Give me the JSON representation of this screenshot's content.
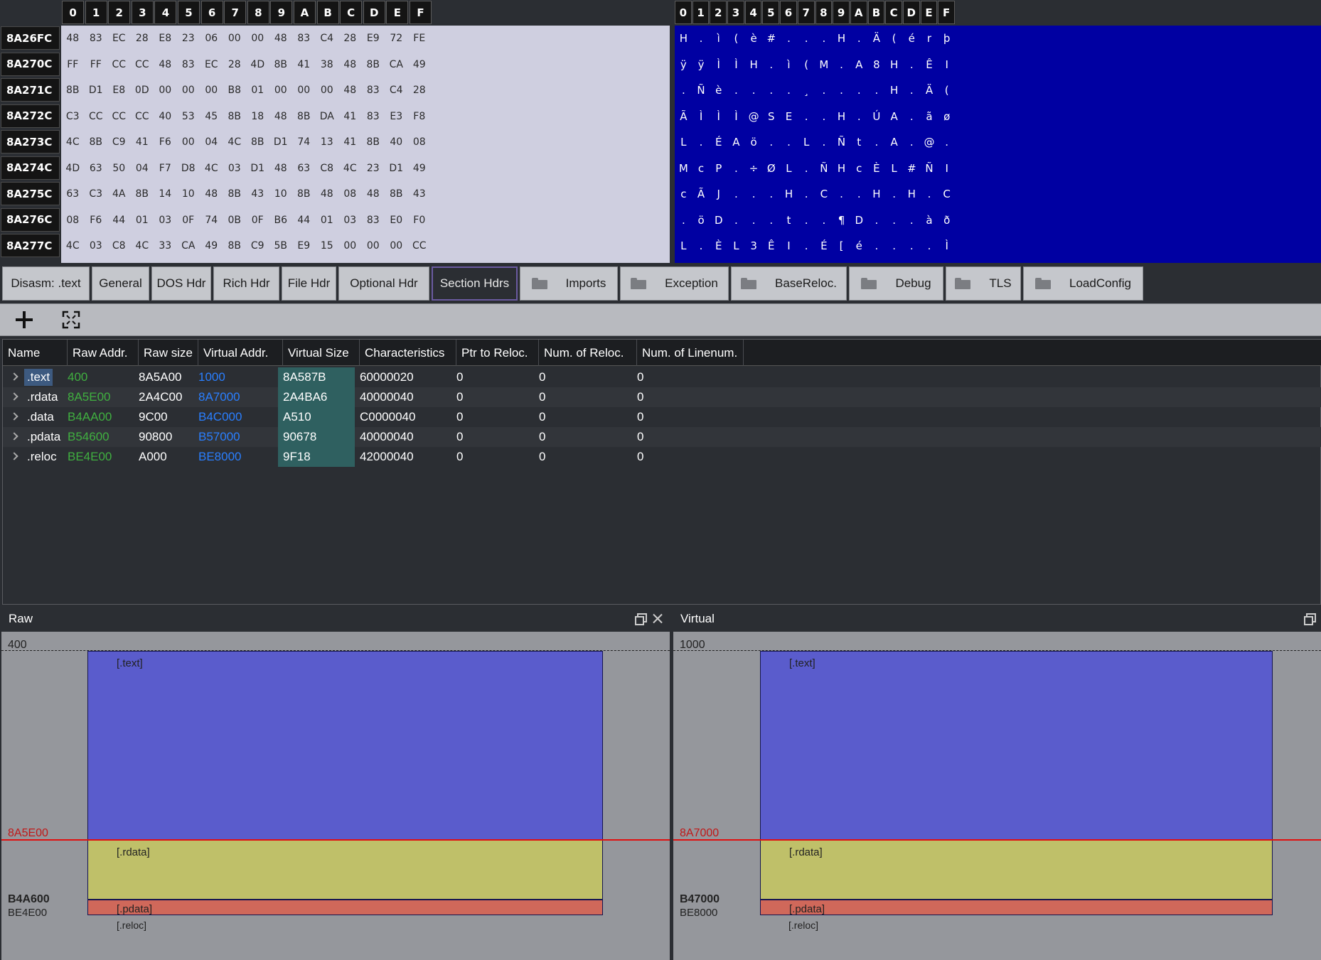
{
  "hex": {
    "columns": [
      "0",
      "1",
      "2",
      "3",
      "4",
      "5",
      "6",
      "7",
      "8",
      "9",
      "A",
      "B",
      "C",
      "D",
      "E",
      "F"
    ],
    "rows": [
      {
        "addr": "8A26FC",
        "bytes": [
          "48",
          "83",
          "EC",
          "28",
          "E8",
          "23",
          "06",
          "00",
          "00",
          "48",
          "83",
          "C4",
          "28",
          "E9",
          "72",
          "FE"
        ],
        "ascii": [
          "H",
          ".",
          "ì",
          "(",
          "è",
          "#",
          ".",
          ".",
          ".",
          "H",
          ".",
          "Ä",
          "(",
          "é",
          "r",
          "þ"
        ]
      },
      {
        "addr": "8A270C",
        "bytes": [
          "FF",
          "FF",
          "CC",
          "CC",
          "48",
          "83",
          "EC",
          "28",
          "4D",
          "8B",
          "41",
          "38",
          "48",
          "8B",
          "CA",
          "49"
        ],
        "ascii": [
          "ÿ",
          "ÿ",
          "Ì",
          "Ì",
          "H",
          ".",
          "ì",
          "(",
          "M",
          ".",
          "A",
          "8",
          "H",
          ".",
          "Ê",
          "I"
        ]
      },
      {
        "addr": "8A271C",
        "bytes": [
          "8B",
          "D1",
          "E8",
          "0D",
          "00",
          "00",
          "00",
          "B8",
          "01",
          "00",
          "00",
          "00",
          "48",
          "83",
          "C4",
          "28"
        ],
        "ascii": [
          ".",
          "Ñ",
          "è",
          ".",
          ".",
          ".",
          ".",
          "¸",
          ".",
          ".",
          ".",
          ".",
          "H",
          ".",
          "Ä",
          "("
        ]
      },
      {
        "addr": "8A272C",
        "bytes": [
          "C3",
          "CC",
          "CC",
          "CC",
          "40",
          "53",
          "45",
          "8B",
          "18",
          "48",
          "8B",
          "DA",
          "41",
          "83",
          "E3",
          "F8"
        ],
        "ascii": [
          "Ã",
          "Ì",
          "Ì",
          "Ì",
          "@",
          "S",
          "E",
          ".",
          ".",
          "H",
          ".",
          "Ú",
          "A",
          ".",
          "ã",
          "ø"
        ]
      },
      {
        "addr": "8A273C",
        "bytes": [
          "4C",
          "8B",
          "C9",
          "41",
          "F6",
          "00",
          "04",
          "4C",
          "8B",
          "D1",
          "74",
          "13",
          "41",
          "8B",
          "40",
          "08"
        ],
        "ascii": [
          "L",
          ".",
          "É",
          "A",
          "ö",
          ".",
          ".",
          "L",
          ".",
          "Ñ",
          "t",
          ".",
          "A",
          ".",
          "@",
          "."
        ]
      },
      {
        "addr": "8A274C",
        "bytes": [
          "4D",
          "63",
          "50",
          "04",
          "F7",
          "D8",
          "4C",
          "03",
          "D1",
          "48",
          "63",
          "C8",
          "4C",
          "23",
          "D1",
          "49"
        ],
        "ascii": [
          "M",
          "c",
          "P",
          ".",
          "÷",
          "Ø",
          "L",
          ".",
          "Ñ",
          "H",
          "c",
          "È",
          "L",
          "#",
          "Ñ",
          "I"
        ]
      },
      {
        "addr": "8A275C",
        "bytes": [
          "63",
          "C3",
          "4A",
          "8B",
          "14",
          "10",
          "48",
          "8B",
          "43",
          "10",
          "8B",
          "48",
          "08",
          "48",
          "8B",
          "43"
        ],
        "ascii": [
          "c",
          "Ã",
          "J",
          ".",
          ".",
          ".",
          "H",
          ".",
          "C",
          ".",
          ".",
          "H",
          ".",
          "H",
          ".",
          "C"
        ]
      },
      {
        "addr": "8A276C",
        "bytes": [
          "08",
          "F6",
          "44",
          "01",
          "03",
          "0F",
          "74",
          "0B",
          "0F",
          "B6",
          "44",
          "01",
          "03",
          "83",
          "E0",
          "F0"
        ],
        "ascii": [
          ".",
          "ö",
          "D",
          ".",
          ".",
          ".",
          "t",
          ".",
          ".",
          "¶",
          "D",
          ".",
          ".",
          ".",
          "à",
          "ð"
        ]
      },
      {
        "addr": "8A277C",
        "bytes": [
          "4C",
          "03",
          "C8",
          "4C",
          "33",
          "CA",
          "49",
          "8B",
          "C9",
          "5B",
          "E9",
          "15",
          "00",
          "00",
          "00",
          "CC"
        ],
        "ascii": [
          "L",
          ".",
          "È",
          "L",
          "3",
          "Ê",
          "I",
          ".",
          "É",
          "[",
          "é",
          ".",
          ".",
          ".",
          ".",
          "Ì"
        ]
      }
    ]
  },
  "tabs": [
    {
      "label": "Disasm: .text",
      "folder": false,
      "active": false
    },
    {
      "label": "General",
      "folder": false,
      "active": false
    },
    {
      "label": "DOS Hdr",
      "folder": false,
      "active": false
    },
    {
      "label": "Rich Hdr",
      "folder": false,
      "active": false
    },
    {
      "label": "File Hdr",
      "folder": false,
      "active": false
    },
    {
      "label": "Optional Hdr",
      "folder": false,
      "active": false
    },
    {
      "label": "Section Hdrs",
      "folder": false,
      "active": true
    },
    {
      "label": "Imports",
      "folder": true,
      "active": false
    },
    {
      "label": "Exception",
      "folder": true,
      "active": false
    },
    {
      "label": "BaseReloc.",
      "folder": true,
      "active": false
    },
    {
      "label": "Debug",
      "folder": true,
      "active": false
    },
    {
      "label": "TLS",
      "folder": true,
      "active": false
    },
    {
      "label": "LoadConfig",
      "folder": true,
      "active": false
    }
  ],
  "toolbar": {
    "add_icon": "plus-icon",
    "fit_icon": "fit-to-view-icon"
  },
  "table": {
    "headers": [
      "Name",
      "Raw Addr.",
      "Raw size",
      "Virtual Addr.",
      "Virtual Size",
      "Characteristics",
      "Ptr to Reloc.",
      "Num. of Reloc.",
      "Num. of Linenum."
    ],
    "rows": [
      {
        "name": ".text",
        "raw_addr": "400",
        "raw_size": "8A5A00",
        "virt_addr": "1000",
        "virt_size": "8A587B",
        "characteristics": "60000020",
        "ptr_reloc": "0",
        "num_reloc": "0",
        "num_linenum": "0"
      },
      {
        "name": ".rdata",
        "raw_addr": "8A5E00",
        "raw_size": "2A4C00",
        "virt_addr": "8A7000",
        "virt_size": "2A4BA6",
        "characteristics": "40000040",
        "ptr_reloc": "0",
        "num_reloc": "0",
        "num_linenum": "0"
      },
      {
        "name": ".data",
        "raw_addr": "B4AA00",
        "raw_size": "9C00",
        "virt_addr": "B4C000",
        "virt_size": "A510",
        "characteristics": "C0000040",
        "ptr_reloc": "0",
        "num_reloc": "0",
        "num_linenum": "0"
      },
      {
        "name": ".pdata",
        "raw_addr": "B54600",
        "raw_size": "90800",
        "virt_addr": "B57000",
        "virt_size": "90678",
        "characteristics": "40000040",
        "ptr_reloc": "0",
        "num_reloc": "0",
        "num_linenum": "0"
      },
      {
        "name": ".reloc",
        "raw_addr": "BE4E00",
        "raw_size": "A000",
        "virt_addr": "BE8000",
        "virt_size": "9F18",
        "characteristics": "42000040",
        "ptr_reloc": "0",
        "num_reloc": "0",
        "num_linenum": "0"
      }
    ]
  },
  "raw_pane": {
    "title": "Raw",
    "top_offset": "400",
    "rdata_offset": "8A5E00",
    "data_offset": "B4A600",
    "end_offset": "BE4E00",
    "labels": {
      "text": "[.text]",
      "rdata": "[.rdata]",
      "data": "[.pdata]",
      "reloc": "[.reloc]"
    }
  },
  "virtual_pane": {
    "title": "Virtual",
    "top_offset": "1000",
    "rdata_offset": "8A7000",
    "data_offset": "B47000",
    "end_offset": "BE8000",
    "labels": {
      "text": "[.text]",
      "rdata": "[.rdata]",
      "data": "[.pdata]",
      "reloc": "[.reloc]"
    }
  },
  "colors": {
    "hex_bg": "#cfcfe0",
    "ascii_bg": "#0000a2",
    "text_seg": "#5a5ccc",
    "rdata_seg": "#bfc069",
    "data_seg": "#d0685a",
    "raw_addr": "#40b040",
    "virt_addr": "#2a7fff"
  }
}
